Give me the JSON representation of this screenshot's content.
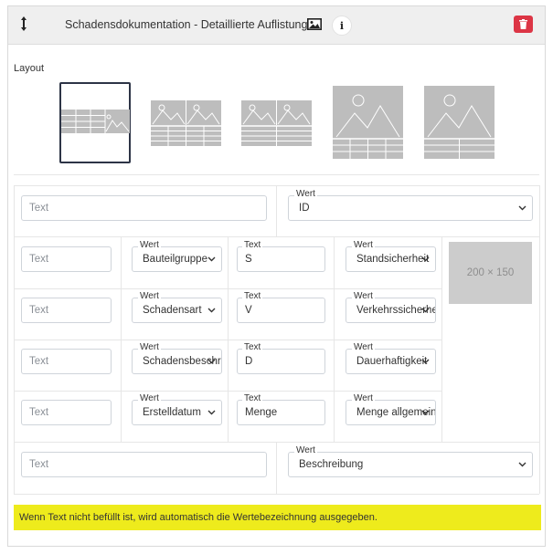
{
  "header": {
    "title": "Schadensdokumentation - Detaillierte Auflistung",
    "drag_icon": "vertical-arrows-icon",
    "image_icon": "image-icon",
    "info_label": "i",
    "delete_icon": "trash-icon",
    "delete_color": "#dc3545"
  },
  "layout": {
    "label": "Layout",
    "options": [
      "table-image-strip",
      "two-images-table",
      "two-images-table-alt",
      "image-table",
      "image-table-list"
    ],
    "selected_index": 0
  },
  "top_row": {
    "text_placeholder": "Text",
    "value_label": "Wert",
    "value": "ID"
  },
  "rows": [
    {
      "text_placeholder": "Text",
      "value1_label": "Wert",
      "value1": "Bauteilgruppe",
      "text2_label": "Text",
      "text2": "S",
      "value2_label": "Wert",
      "value2": "Standsicherheit"
    },
    {
      "text_placeholder": "Text",
      "value1_label": "Wert",
      "value1": "Schadensart",
      "text2_label": "Text",
      "text2": "V",
      "value2_label": "Wert",
      "value2": "Verkehrssicherheit"
    },
    {
      "text_placeholder": "Text",
      "value1_label": "Wert",
      "value1": "Schadensbeschreibung",
      "text2_label": "Text",
      "text2": "D",
      "value2_label": "Wert",
      "value2": "Dauerhaftigkeit"
    },
    {
      "text_placeholder": "Text",
      "value1_label": "Wert",
      "value1": "Erstelldatum",
      "text2_label": "Text",
      "text2": "Menge",
      "value2_label": "Wert",
      "value2": "Menge allgemein"
    }
  ],
  "image_placeholder": "200 × 150",
  "bottom_row": {
    "text_placeholder": "Text",
    "value_label": "Wert",
    "value": "Beschreibung"
  },
  "notice": {
    "text": "Wenn Text nicht befüllt ist, wird automatisch die Wertebezeichnung ausgegeben.",
    "color": "#eeeb1c"
  }
}
